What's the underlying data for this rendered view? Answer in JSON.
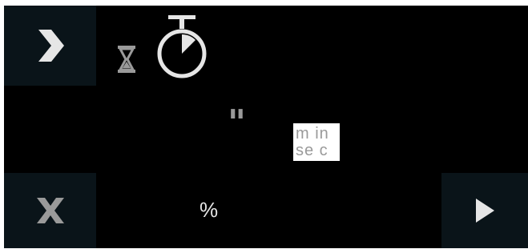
{
  "icons": {
    "forward": "chevron-right-icon",
    "close": "close-icon",
    "play": "play-icon",
    "hourglass": "hourglass-icon",
    "stopwatch": "stopwatch-icon"
  },
  "timer": {
    "separator": "\"",
    "unit_line1": "m in",
    "unit_line2": "se c"
  },
  "progress": {
    "symbol": "%"
  },
  "colors": {
    "background": "#000000",
    "tile": "#0a1419",
    "icon_light": "#e6e6e6",
    "icon_gray": "#9a9a9a"
  }
}
